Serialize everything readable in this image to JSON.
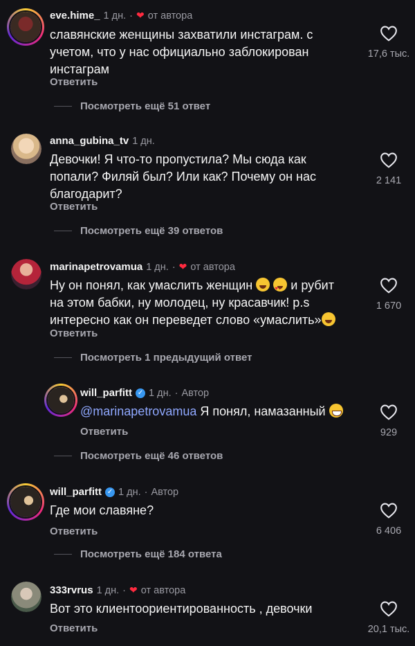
{
  "comments": [
    {
      "user": "eve.hime_",
      "time": "1 дн.",
      "dot": "·",
      "liked_by_author": "от автора",
      "text": "славянские женщины захватили инстаграм. с учетом, что у нас официально заблокирован инстаграм",
      "reply_label": "Ответить",
      "likes": "17,6 тыс.",
      "more_replies": "Посмотреть ещё 51 ответ",
      "avatar_icon": "avatar-eve-hime"
    },
    {
      "user": "anna_gubina_tv",
      "time": "1 дн.",
      "text": "Девочки! Я что-то пропустила? Мы сюда как попали? Филяй был? Или как? Почему он нас благодарит?",
      "reply_label": "Ответить",
      "likes": "2 141",
      "more_replies": "Посмотреть ещё 39 ответов",
      "avatar_icon": "avatar-anna-gubina"
    },
    {
      "user": "marinapetrovamua",
      "time": "1 дн.",
      "dot": "·",
      "liked_by_author": "от автора",
      "text_line1": "Ну он понял, как умаслить женщин",
      "text_line1_end": "и рубит",
      "text_line2": "на этом бабки, ну молодец, ну красавчик! p.s",
      "text_line3": "интересно как он переведет слово «умаслить»",
      "emoji1": "laughing-tears-emoji",
      "emoji2": "heart-eyes-emoji",
      "emoji3": "laughing-tears-emoji",
      "reply_label": "Ответить",
      "likes": "1 670",
      "more_replies": "Посмотреть 1 предыдущий ответ",
      "avatar_icon": "avatar-marinapetrovamua"
    },
    {
      "user": "will_parfitt",
      "verified_icon": "verified-badge-icon",
      "time": "1 дн.",
      "dot": "·",
      "author_label": "Автор",
      "mention": "@marinapetrovamua",
      "text": "Я понял, намазанный",
      "emoji": "grinning-emoji",
      "reply_label": "Ответить",
      "likes": "929",
      "more_replies": "Посмотреть ещё 46 ответов",
      "avatar_icon": "avatar-will-parfitt"
    },
    {
      "user": "will_parfitt",
      "verified_icon": "verified-badge-icon",
      "time": "1 дн.",
      "dot": "·",
      "author_label": "Автор",
      "text": "Где мои славяне?",
      "reply_label": "Ответить",
      "likes": "6 406",
      "more_replies": "Посмотреть ещё 184 ответа",
      "avatar_icon": "avatar-will-parfitt"
    },
    {
      "user": "333rvrus",
      "time": "1 дн.",
      "dot": "·",
      "liked_by_author": "от автора",
      "text": "Вот это клиентоориентированность , девочки",
      "reply_label": "Ответить",
      "likes": "20,1 тыс.",
      "avatar_icon": "avatar-333rvrus"
    }
  ],
  "colors": {
    "background": "#121216",
    "text": "#f5f5f5",
    "muted": "#a8a8b0",
    "author_heart": "#ff2a3f",
    "mention": "#8fa8ff",
    "verified": "#3897f0"
  }
}
